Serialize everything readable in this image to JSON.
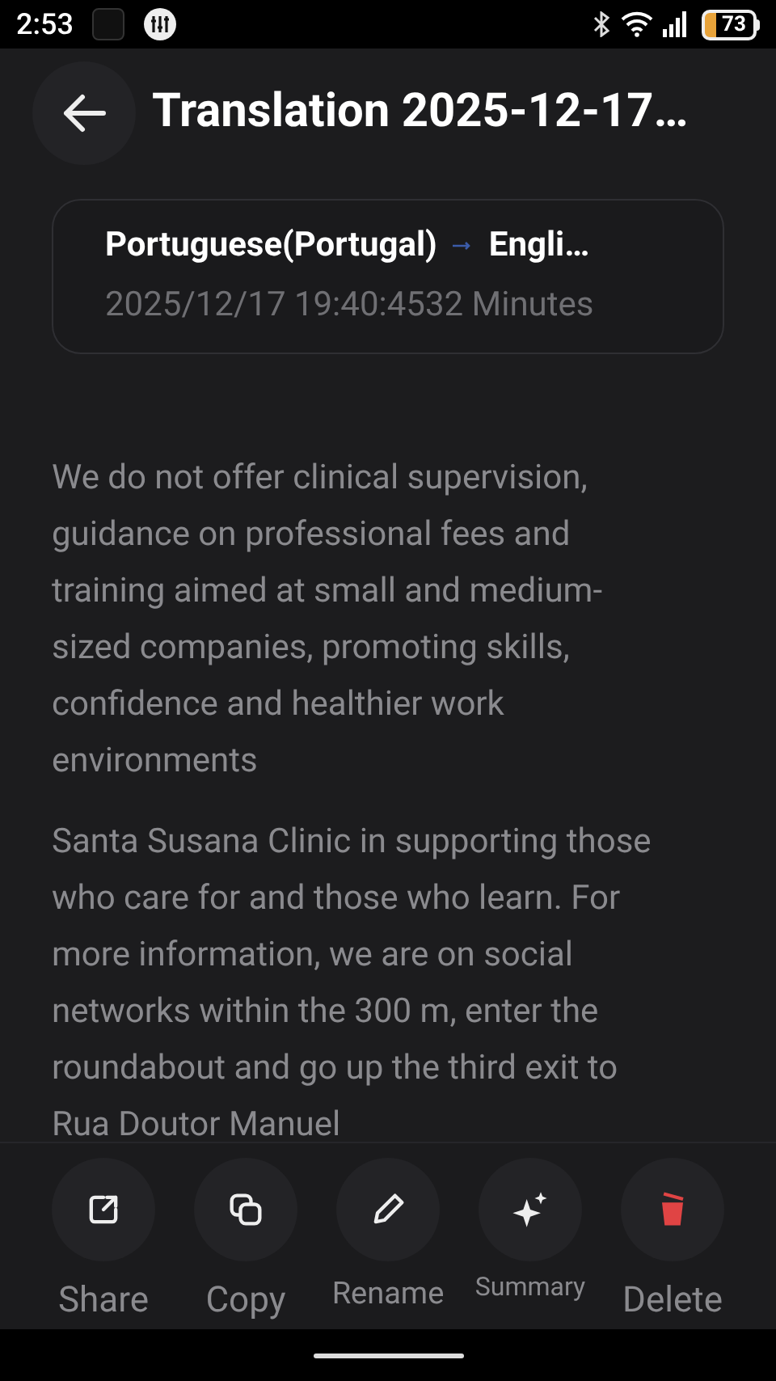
{
  "status_bar": {
    "time": "2:53",
    "battery": "73"
  },
  "header": {
    "title": "Translation 2025-12-17…"
  },
  "info_card": {
    "source_language": "Portuguese(Portugal)",
    "target_language": "Engli…",
    "timestamp": "2025/12/17 19:40:45",
    "duration": "32 Minutes"
  },
  "paragraphs": [
    "We do not offer clinical supervision, guidance on professional fees and training aimed at small and medium-sized companies, promoting skills, confidence and healthier work environments",
    "Santa Susana Clinic in supporting those who care for and those who learn. For more information, we are on social networks within the 300 m, enter the roundabout and go up the third exit to Rua Doutor Manuel"
  ],
  "actions": [
    {
      "kind": "share",
      "label": "Share"
    },
    {
      "kind": "copy",
      "label": "Copy"
    },
    {
      "kind": "rename",
      "label": "Rename"
    },
    {
      "kind": "summary",
      "label": "Summary"
    },
    {
      "kind": "delete",
      "label": "Delete"
    }
  ]
}
